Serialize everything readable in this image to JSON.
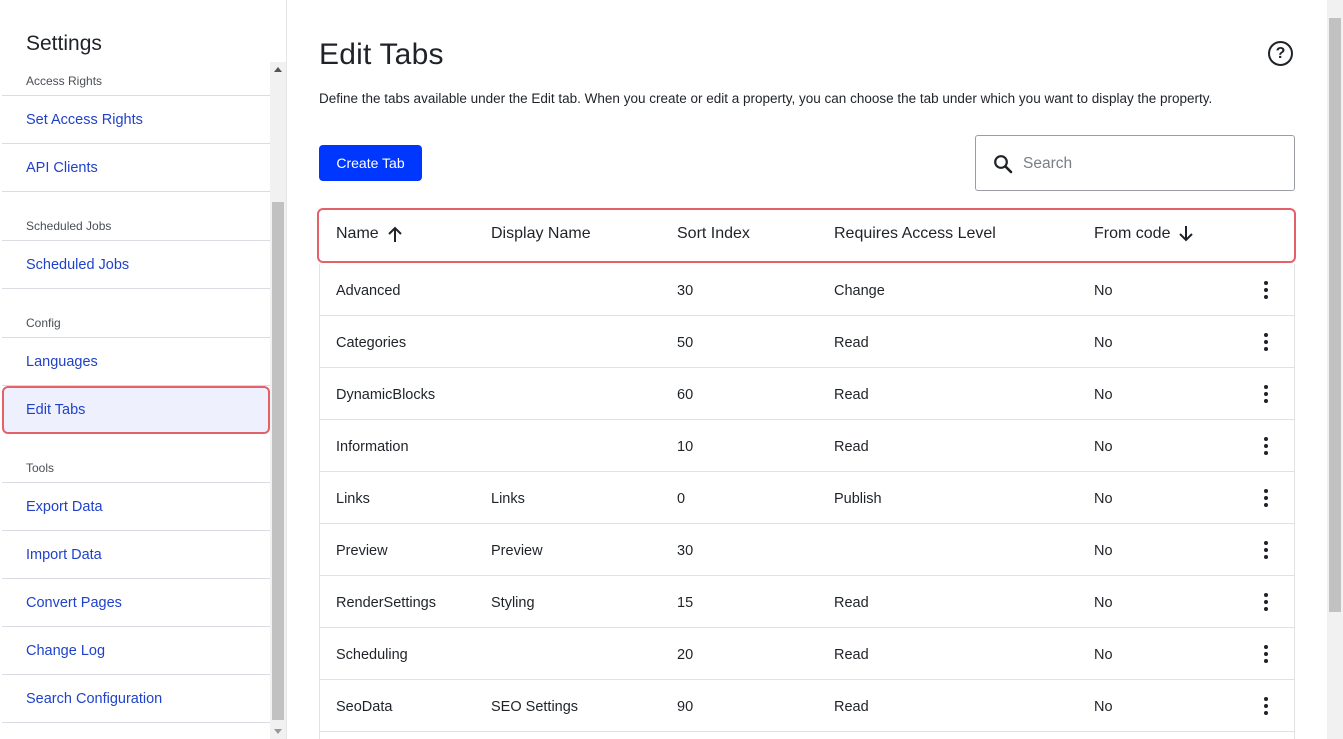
{
  "sidebar": {
    "title": "Settings",
    "sections": [
      {
        "group": "Access Rights",
        "items": [
          "Set Access Rights",
          "API Clients"
        ]
      },
      {
        "group": "Scheduled Jobs",
        "items": [
          "Scheduled Jobs"
        ]
      },
      {
        "group": "Config",
        "items": [
          "Languages",
          "Edit Tabs"
        ]
      },
      {
        "group": "Tools",
        "items": [
          "Export Data",
          "Import Data",
          "Convert Pages",
          "Change Log",
          "Search Configuration"
        ]
      }
    ],
    "active_item": "Edit Tabs"
  },
  "page": {
    "title": "Edit Tabs",
    "help_label": "?",
    "description": "Define the tabs available under the Edit tab. When you create or edit a property, you can choose the tab under which you want to display the property.",
    "create_button": "Create Tab",
    "search_placeholder": "Search"
  },
  "table": {
    "columns": [
      "Name",
      "Display Name",
      "Sort Index",
      "Requires Access Level",
      "From code"
    ],
    "sort": {
      "Name": "ascending",
      "From code": "descending"
    },
    "rows": [
      [
        "Advanced",
        "",
        "30",
        "Change",
        "No"
      ],
      [
        "Categories",
        "",
        "50",
        "Read",
        "No"
      ],
      [
        "DynamicBlocks",
        "",
        "60",
        "Read",
        "No"
      ],
      [
        "Information",
        "",
        "10",
        "Read",
        "No"
      ],
      [
        "Links",
        "Links",
        "0",
        "Publish",
        "No"
      ],
      [
        "Preview",
        "Preview",
        "30",
        "",
        "No"
      ],
      [
        "RenderSettings",
        "Styling",
        "15",
        "Read",
        "No"
      ],
      [
        "Scheduling",
        "",
        "20",
        "Read",
        "No"
      ],
      [
        "SeoData",
        "SEO Settings",
        "90",
        "Read",
        "No"
      ]
    ]
  },
  "colors": {
    "accent": "#0037ff",
    "link": "#2042c9",
    "highlight_border": "#e5616a",
    "active_bg": "#eef1fd"
  }
}
